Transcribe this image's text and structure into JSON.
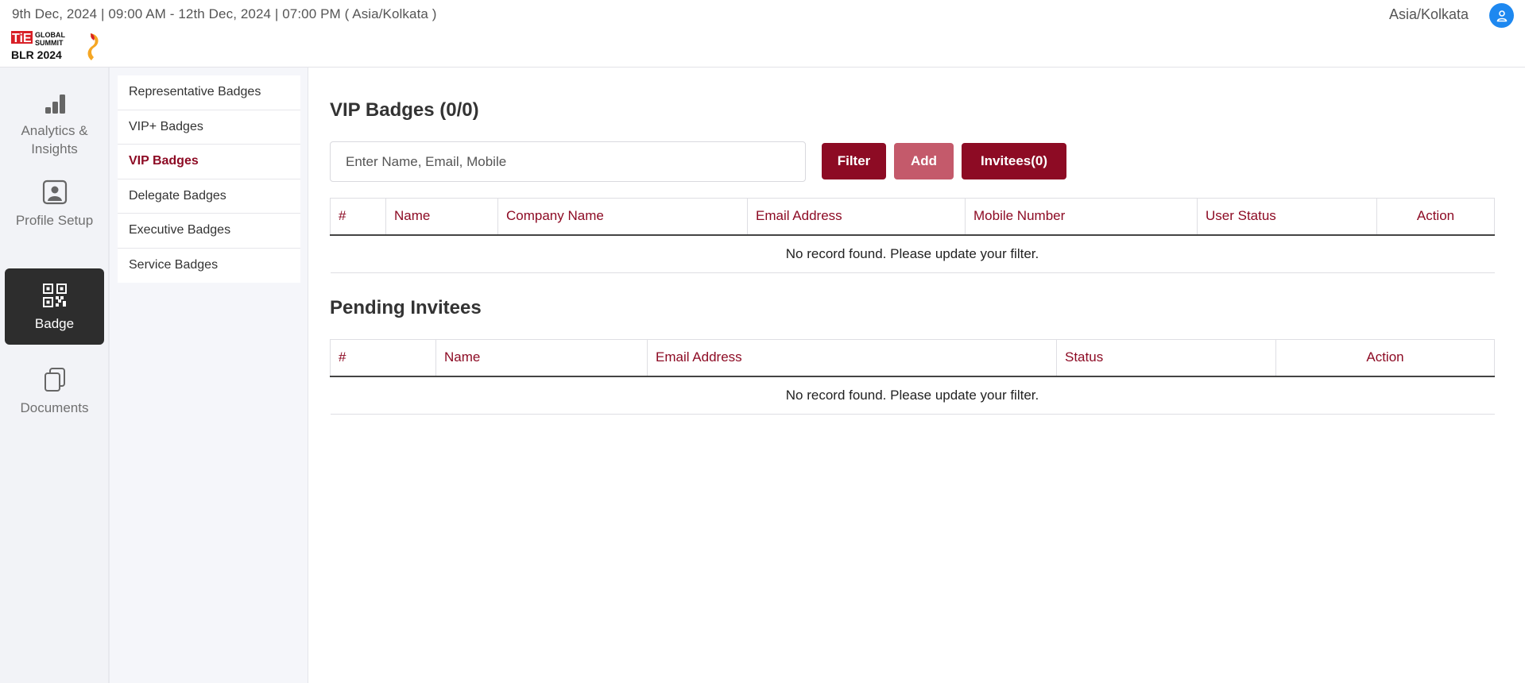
{
  "header": {
    "event_dates": "9th Dec, 2024 | 09:00 AM - 12th Dec, 2024 | 07:00 PM ( Asia/Kolkata )",
    "timezone": "Asia/Kolkata",
    "logo": {
      "line1": "TiE",
      "line2": "GLOBAL",
      "line3": "SUMMIT",
      "line4": "BLR 2024"
    }
  },
  "rail": {
    "items": [
      {
        "label": "Analytics & Insights",
        "icon": "bar-chart-icon"
      },
      {
        "label": "Profile Setup",
        "icon": "profile-card-icon"
      },
      {
        "label": "Badge",
        "icon": "qr-code-icon",
        "active": true
      },
      {
        "label": "Documents",
        "icon": "documents-icon"
      }
    ]
  },
  "submenu": {
    "items": [
      {
        "label": "Representative Badges"
      },
      {
        "label": "VIP+ Badges"
      },
      {
        "label": "VIP Badges",
        "active": true
      },
      {
        "label": "Delegate Badges"
      },
      {
        "label": "Executive Badges"
      },
      {
        "label": "Service Badges"
      }
    ]
  },
  "main": {
    "title": "VIP Badges (0/0)",
    "search_placeholder": "Enter Name, Email, Mobile",
    "filter_label": "Filter",
    "add_label": "Add",
    "invitees_label": "Invitees(0)",
    "badges_table": {
      "columns": [
        "#",
        "Name",
        "Company Name",
        "Email Address",
        "Mobile Number",
        "User Status",
        "Action"
      ],
      "empty_message": "No record found. Please update your filter."
    },
    "pending_title": "Pending Invitees",
    "pending_table": {
      "columns": [
        "#",
        "Name",
        "Email Address",
        "Status",
        "Action"
      ],
      "empty_message": "No record found. Please update your filter."
    }
  },
  "colors": {
    "brand": "#8d0b24",
    "brand_disabled": "#c45a6b",
    "avatar": "#1e88f0",
    "rail_active": "#2d2d2d"
  }
}
